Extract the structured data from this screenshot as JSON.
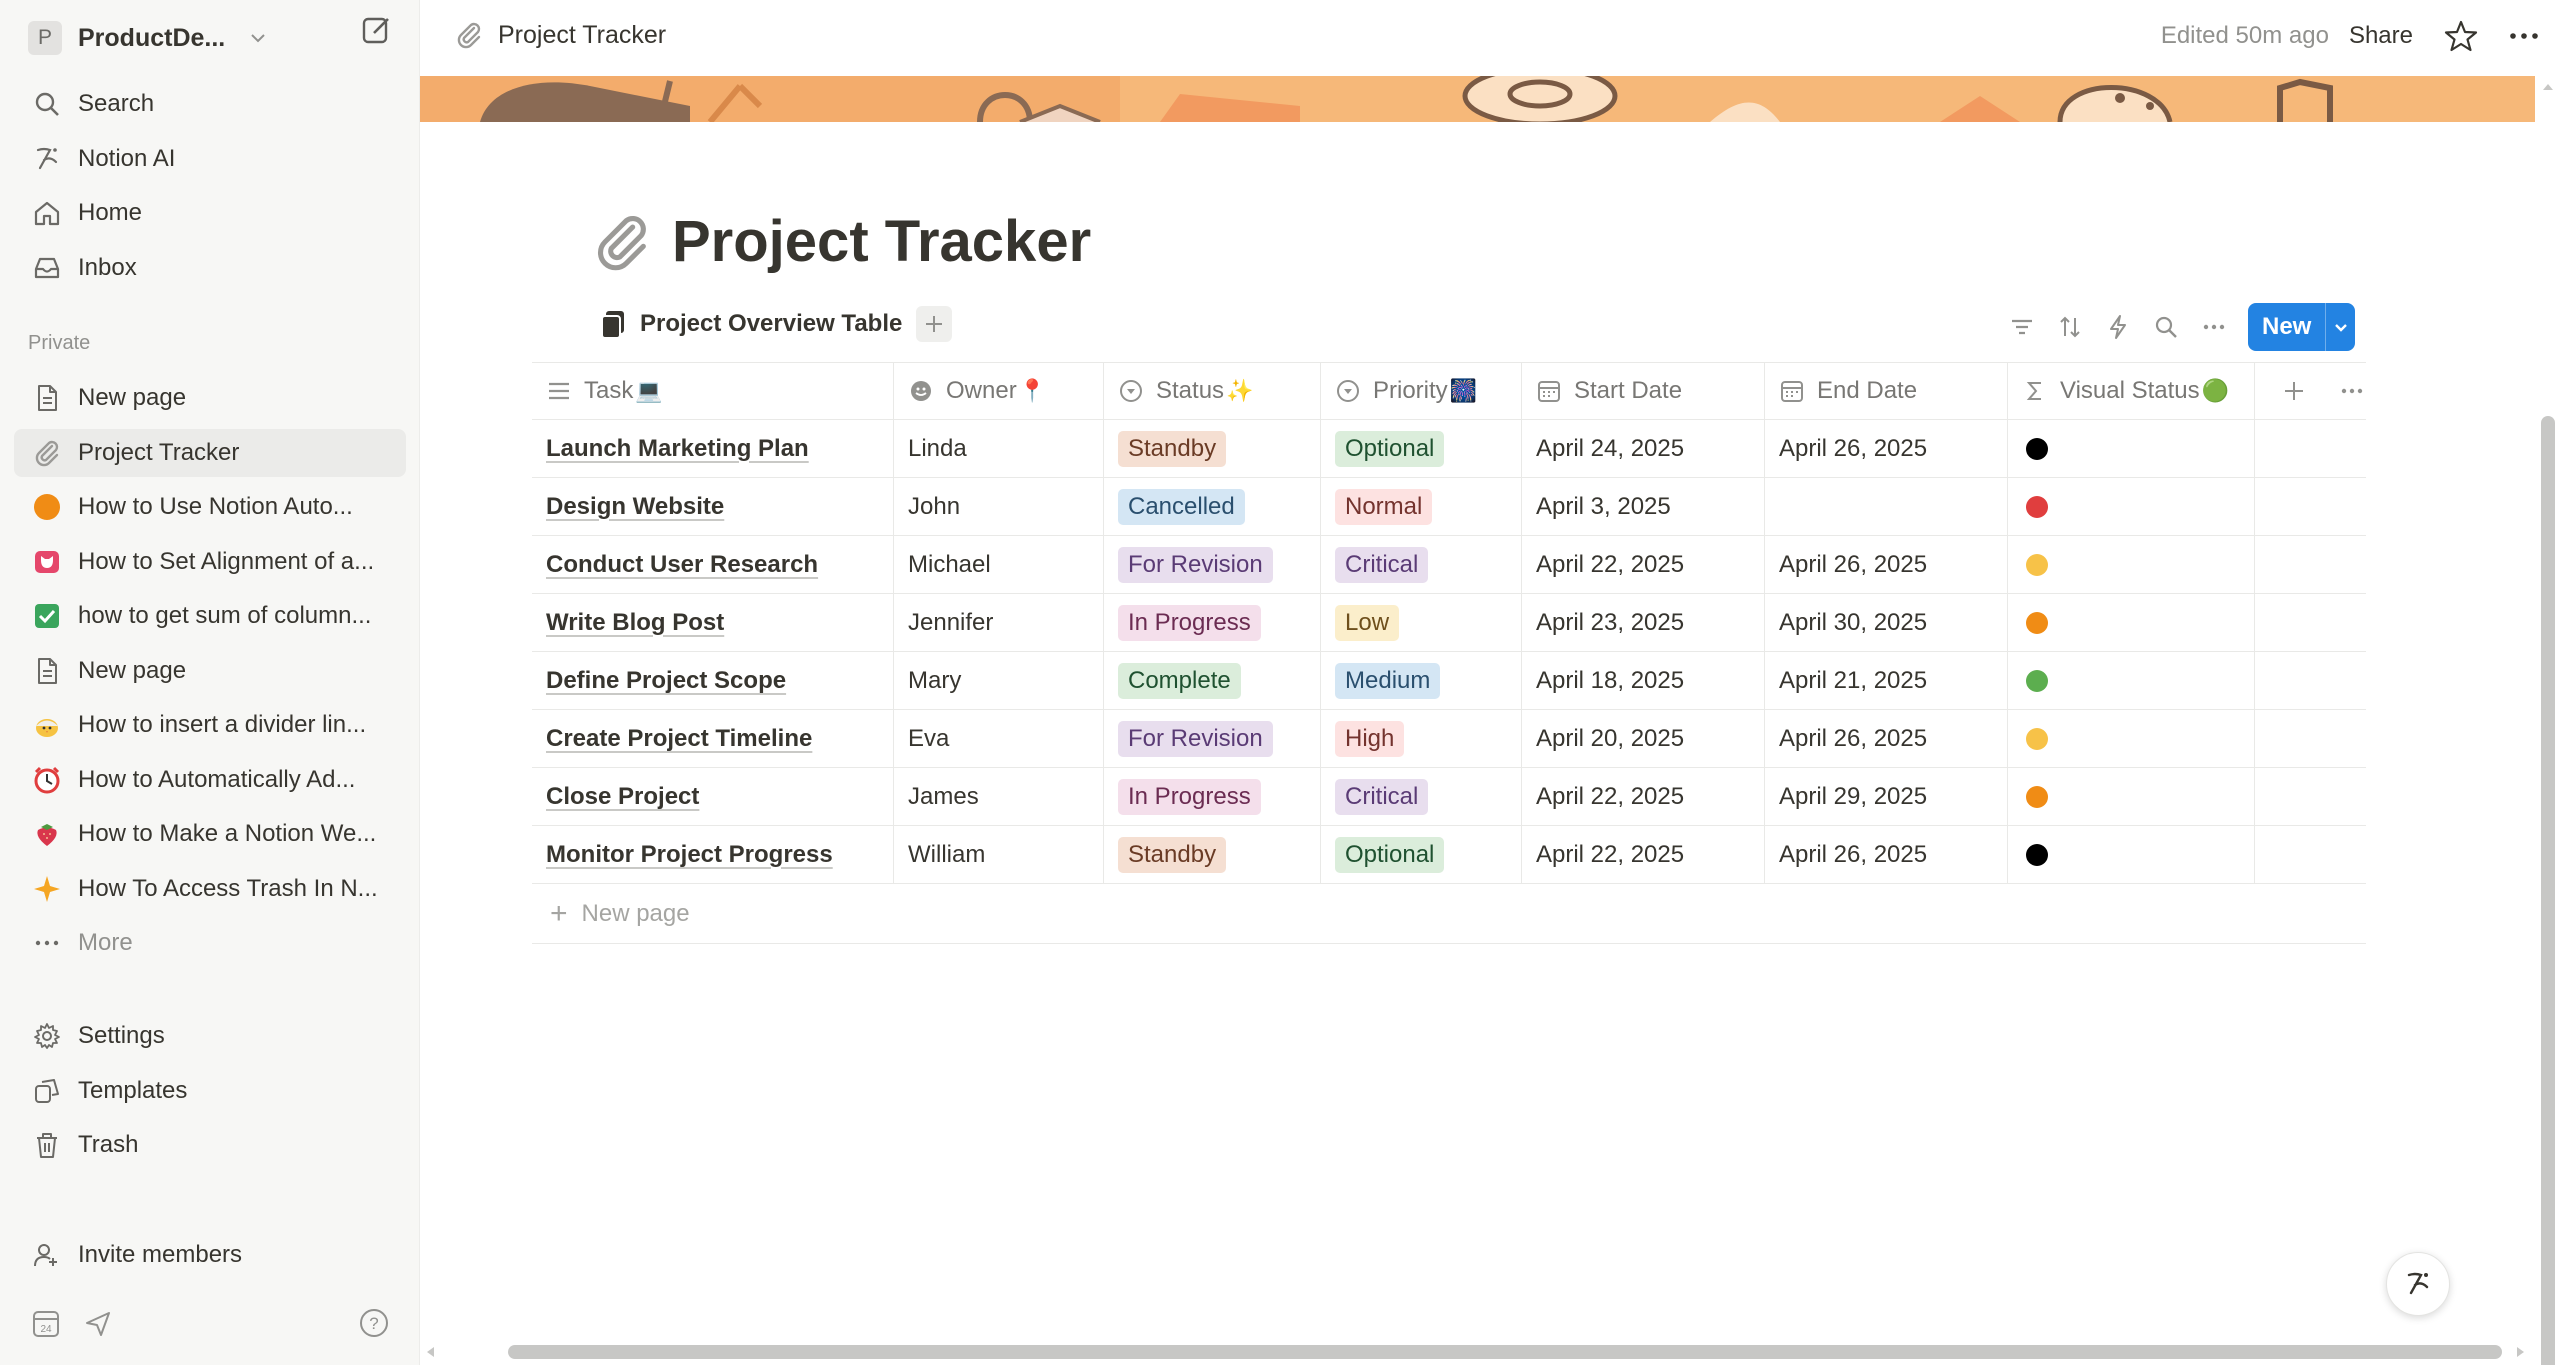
{
  "sidebar": {
    "workspace": {
      "initial": "P",
      "name": "ProductDe..."
    },
    "top_items": [
      {
        "label": "Search",
        "icon": "search-icon"
      },
      {
        "label": "Notion AI",
        "icon": "notion-ai-icon"
      },
      {
        "label": "Home",
        "icon": "home-icon"
      },
      {
        "label": "Inbox",
        "icon": "inbox-icon"
      }
    ],
    "section_label": "Private",
    "pages": [
      {
        "label": "New page",
        "icon": "page-icon"
      },
      {
        "label": "Project Tracker",
        "icon": "paperclip-icon"
      },
      {
        "label": "How to Use Notion Auto...",
        "icon": "orange-circle-icon"
      },
      {
        "label": "How to Set Alignment of a...",
        "icon": "pink-cat-icon"
      },
      {
        "label": "how to get sum of column...",
        "icon": "green-check-icon"
      },
      {
        "label": "New page",
        "icon": "page-icon"
      },
      {
        "label": "How to insert a divider lin...",
        "icon": "chick-icon"
      },
      {
        "label": "How to Automatically Ad...",
        "icon": "alarm-clock-icon"
      },
      {
        "label": "How to Make a Notion We...",
        "icon": "strawberry-icon"
      },
      {
        "label": "How To Access Trash In N...",
        "icon": "sparkle-icon"
      },
      {
        "label": "More",
        "icon": "more-dots-icon"
      }
    ],
    "bottom_items": [
      {
        "label": "Settings",
        "icon": "gear-icon"
      },
      {
        "label": "Templates",
        "icon": "templates-icon"
      },
      {
        "label": "Trash",
        "icon": "trash-icon"
      }
    ],
    "invite": {
      "label": "Invite members",
      "icon": "invite-icon"
    }
  },
  "topbar": {
    "breadcrumb": "Project Tracker",
    "edited": "Edited 50m ago",
    "share": "Share"
  },
  "page": {
    "title": "Project Tracker",
    "view_tab": "Project Overview Table",
    "new_button": "New"
  },
  "table": {
    "columns": [
      {
        "label": "Task",
        "emoji": "💻"
      },
      {
        "label": "Owner",
        "emoji": "📍"
      },
      {
        "label": "Status",
        "emoji": "✨"
      },
      {
        "label": "Priority",
        "emoji": "🎆"
      },
      {
        "label": "Start Date",
        "emoji": ""
      },
      {
        "label": "End Date",
        "emoji": ""
      },
      {
        "label": "Visual Status",
        "emoji": "🟢"
      }
    ],
    "rows": [
      {
        "task": "Launch Marketing Plan",
        "owner": "Linda",
        "status": "Standby",
        "priority": "Optional",
        "start": "April 24, 2025",
        "end": "April 26, 2025",
        "visual": "#000000"
      },
      {
        "task": "Design Website",
        "owner": "John",
        "status": "Cancelled",
        "priority": "Normal",
        "start": "April 3, 2025",
        "end": "",
        "visual": "#e03e3e"
      },
      {
        "task": "Conduct User Research",
        "owner": "Michael",
        "status": "For Revision",
        "priority": "Critical",
        "start": "April 22, 2025",
        "end": "April 26, 2025",
        "visual": "#f7c248"
      },
      {
        "task": "Write Blog Post",
        "owner": "Jennifer",
        "status": "In Progress",
        "priority": "Low",
        "start": "April 23, 2025",
        "end": "April 30, 2025",
        "visual": "#f08c15"
      },
      {
        "task": "Define Project Scope",
        "owner": "Mary",
        "status": "Complete",
        "priority": "Medium",
        "start": "April 18, 2025",
        "end": "April 21, 2025",
        "visual": "#5cae4f"
      },
      {
        "task": "Create Project Timeline",
        "owner": "Eva",
        "status": "For Revision",
        "priority": "High",
        "start": "April 20, 2025",
        "end": "April 26, 2025",
        "visual": "#f7c248"
      },
      {
        "task": "Close Project",
        "owner": "James",
        "status": "In Progress",
        "priority": "Critical",
        "start": "April 22, 2025",
        "end": "April 29, 2025",
        "visual": "#f08c15"
      },
      {
        "task": "Monitor Project Progress",
        "owner": "William",
        "status": "Standby",
        "priority": "Optional",
        "start": "April 22, 2025",
        "end": "April 26, 2025",
        "visual": "#000000"
      }
    ],
    "new_row_label": "New page"
  },
  "tag_colors": {
    "Standby": {
      "bg": "#f5dfd2",
      "fg": "#6a3b25"
    },
    "Cancelled": {
      "bg": "#d4e6f4",
      "fg": "#2a4f6e"
    },
    "For Revision": {
      "bg": "#e8deee",
      "fg": "#5a3b75"
    },
    "In Progress": {
      "bg": "#f4dfeb",
      "fg": "#6b2c52"
    },
    "Complete": {
      "bg": "#dbeddb",
      "fg": "#1f5130"
    },
    "Optional": {
      "bg": "#dbeddb",
      "fg": "#1f5130"
    },
    "Normal": {
      "bg": "#fde2e1",
      "fg": "#74332e"
    },
    "Critical": {
      "bg": "#e8deee",
      "fg": "#5a3b75"
    },
    "Low": {
      "bg": "#fbeecb",
      "fg": "#6e4f1c"
    },
    "Medium": {
      "bg": "#d4e6f4",
      "fg": "#2a4f6e"
    },
    "High": {
      "bg": "#fde2e1",
      "fg": "#74332e"
    }
  },
  "accent_color": "#2383e2"
}
